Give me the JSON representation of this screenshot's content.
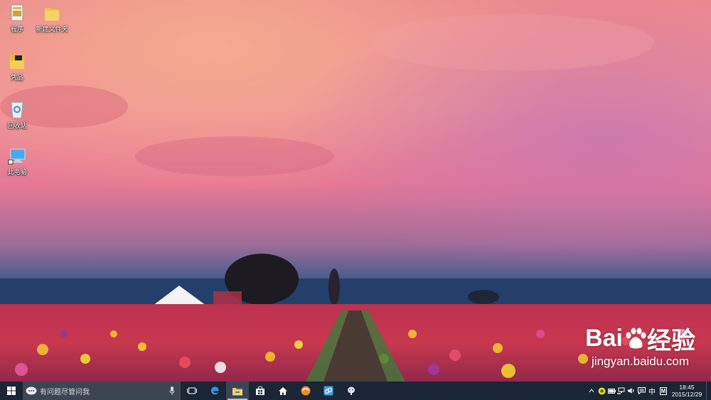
{
  "desktop": {
    "icons": [
      {
        "label": "程序",
        "icon": "file-icon"
      },
      {
        "label": "新建文件夹",
        "icon": "folder-icon"
      },
      {
        "label": "凭品",
        "icon": "folder-icon"
      },
      {
        "label": "回收站",
        "icon": "recycle-bin-icon"
      },
      {
        "label": "此电脑",
        "icon": "this-pc-icon"
      }
    ]
  },
  "watermark": {
    "brand_prefix": "Bai",
    "brand_suffix": "经验",
    "url": "jingyan.baidu.com"
  },
  "taskbar": {
    "search_placeholder": "有问题尽管问我",
    "apps": [
      "task-view-icon",
      "edge-icon",
      "file-explorer-icon",
      "store-icon",
      "home-icon",
      "browser-icon",
      "app-icon",
      "app-icon"
    ],
    "tray": {
      "ime_label": "中",
      "ime_mode": "M",
      "time": "18:45",
      "date": "2015/12/29"
    }
  },
  "colors": {
    "taskbar_bg": "#1a2535",
    "search_bg": "#3c4553",
    "accent": "#9cc8f5"
  }
}
